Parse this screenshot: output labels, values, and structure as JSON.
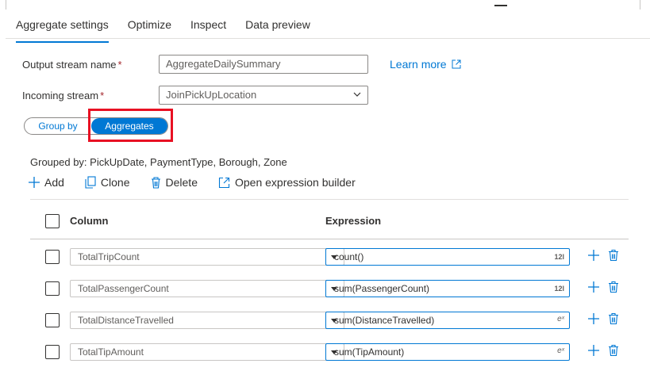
{
  "tabs": [
    "Aggregate settings",
    "Optimize",
    "Inspect",
    "Data preview"
  ],
  "output_stream": {
    "label": "Output stream name",
    "required_mark": "*",
    "value": "AggregateDailySummary"
  },
  "incoming_stream": {
    "label": "Incoming stream",
    "required_mark": "*",
    "value": "JoinPickUpLocation"
  },
  "learn_more": "Learn more",
  "toggle": {
    "left": "Group by",
    "right": "Aggregates",
    "selected": "Aggregates"
  },
  "grouped_by": "Grouped by: PickUpDate, PaymentType, Borough, Zone",
  "commands": {
    "add": "Add",
    "clone": "Clone",
    "delete": "Delete",
    "open_builder": "Open expression builder"
  },
  "grid": {
    "headers": {
      "column": "Column",
      "expression": "Expression"
    },
    "rows": [
      {
        "column": "TotalTripCount",
        "expression": "count()",
        "type_icon": "12l"
      },
      {
        "column": "TotalPassengerCount",
        "expression": "sum(PassengerCount)",
        "type_icon": "12l"
      },
      {
        "column": "TotalDistanceTravelled",
        "expression": "sum(DistanceTravelled)",
        "type_icon": "eˣ"
      },
      {
        "column": "TotalTipAmount",
        "expression": "sum(TipAmount)",
        "type_icon": "eˣ"
      }
    ]
  },
  "colors": {
    "accent": "#0078d4",
    "highlight": "#e81123",
    "required": "#a4262c"
  }
}
